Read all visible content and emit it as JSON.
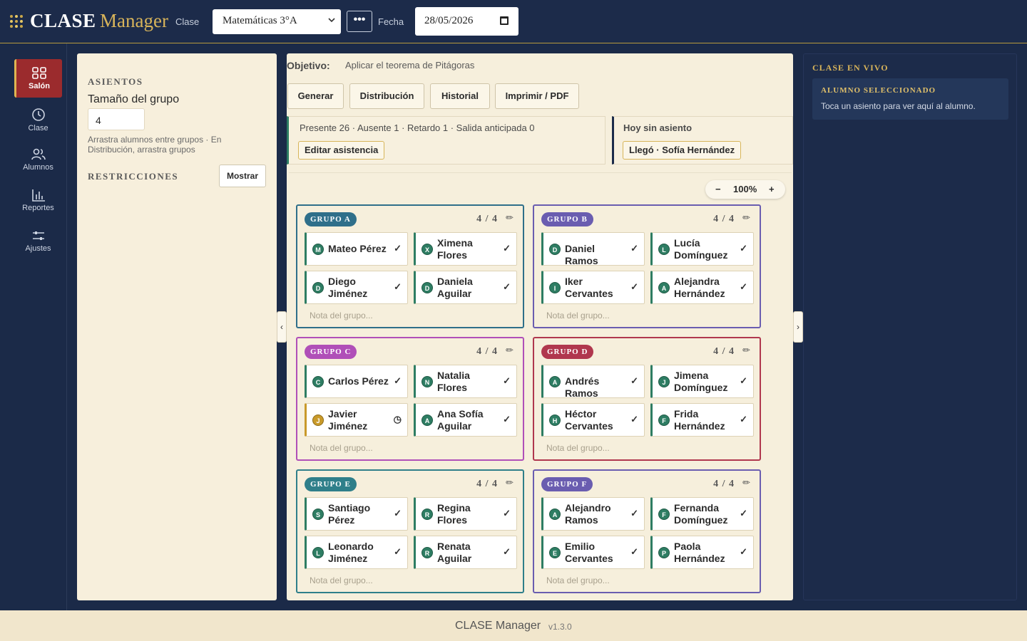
{
  "app": {
    "brand": "CLASE",
    "brand_sub": "Manager",
    "footer_name": "CLASE Manager",
    "version": "v1.3.0"
  },
  "topbar": {
    "class_label": "Clase",
    "class_value": "Matemáticas 3°A",
    "more_label": "•••",
    "date_label": "Fecha",
    "date_value": "28/05/2026"
  },
  "nav": [
    {
      "label": "Salón",
      "icon": "grid-icon",
      "active": true
    },
    {
      "label": "Clase",
      "icon": "clock-icon",
      "active": false
    },
    {
      "label": "Alumnos",
      "icon": "users-icon",
      "active": false
    },
    {
      "label": "Reportes",
      "icon": "bar-chart-icon",
      "active": false
    },
    {
      "label": "Ajustes",
      "icon": "sliders-icon",
      "active": false
    }
  ],
  "left": {
    "seats_title": "ASIENTOS",
    "group_size_label": "Tamaño del grupo",
    "group_size_value": "4",
    "hint": "Arrastra alumnos entre grupos · En Distribución, arrastra grupos",
    "restrictions_title": "RESTRICCIONES",
    "show_label": "Mostrar"
  },
  "main": {
    "objective_label": "Objetivo:",
    "objective_text": "Aplicar el teorema de Pitágoras",
    "tabs": [
      "Generar",
      "Distribución",
      "Historial",
      "Imprimir / PDF"
    ],
    "attendance_text": "Presente 26 · Ausente 1 · Retardo 1 · Salida anticipada 0",
    "edit_attendance": "Editar asistencia",
    "no_seat_title": "Hoy sin asiento",
    "arrived_label": "Llegó · Sofía Hernández",
    "zoom_minus": "−",
    "zoom_value": "100%",
    "zoom_plus": "+",
    "collapse_left": "‹",
    "collapse_right": "›"
  },
  "groups": [
    {
      "badge": "GRUPO A",
      "count": "4 / 4",
      "color": "#2f6f8a",
      "note": "Nota del grupo...",
      "seats": [
        {
          "initial": "M",
          "name": "Mateo Pérez",
          "status": "✓"
        },
        {
          "initial": "X",
          "name": "Ximena Flores",
          "status": "✓"
        },
        {
          "initial": "D",
          "name": "Diego Jiménez",
          "status": "✓"
        },
        {
          "initial": "D",
          "name": "Daniela Aguilar",
          "status": "✓"
        }
      ]
    },
    {
      "badge": "GRUPO B",
      "count": "4 / 4",
      "color": "#6a5db0",
      "note": "Nota del grupo...",
      "seats": [
        {
          "initial": "D",
          "name": "Daniel Ramos",
          "status": "✓"
        },
        {
          "initial": "L",
          "name": "Lucía Domínguez",
          "status": "✓"
        },
        {
          "initial": "I",
          "name": "Iker Cervantes",
          "status": "✓"
        },
        {
          "initial": "A",
          "name": "Alejandra Hernández",
          "status": "✓"
        }
      ]
    },
    {
      "badge": "GRUPO C",
      "count": "4 / 4",
      "color": "#b04fb8",
      "note": "Nota del grupo...",
      "seats": [
        {
          "initial": "C",
          "name": "Carlos Pérez",
          "status": "✓"
        },
        {
          "initial": "N",
          "name": "Natalia Flores",
          "status": "✓"
        },
        {
          "initial": "J",
          "name": "Javier Jiménez",
          "status": "◷",
          "late": true
        },
        {
          "initial": "A",
          "name": "Ana Sofía Aguilar",
          "status": "✓"
        }
      ]
    },
    {
      "badge": "GRUPO D",
      "count": "4 / 4",
      "color": "#b0374e",
      "note": "Nota del grupo...",
      "seats": [
        {
          "initial": "A",
          "name": "Andrés Ramos",
          "status": "✓"
        },
        {
          "initial": "J",
          "name": "Jimena Domínguez",
          "status": "✓"
        },
        {
          "initial": "H",
          "name": "Héctor Cervantes",
          "status": "✓"
        },
        {
          "initial": "F",
          "name": "Frida Hernández",
          "status": "✓"
        }
      ]
    },
    {
      "badge": "GRUPO E",
      "count": "4 / 4",
      "color": "#2f7f8a",
      "note": "Nota del grupo...",
      "seats": [
        {
          "initial": "S",
          "name": "Santiago Pérez",
          "status": "✓"
        },
        {
          "initial": "R",
          "name": "Regina Flores",
          "status": "✓"
        },
        {
          "initial": "L",
          "name": "Leonardo Jiménez",
          "status": "✓"
        },
        {
          "initial": "R",
          "name": "Renata Aguilar",
          "status": "✓"
        }
      ]
    },
    {
      "badge": "GRUPO F",
      "count": "4 / 4",
      "color": "#6a5db0",
      "note": "Nota del grupo...",
      "seats": [
        {
          "initial": "A",
          "name": "Alejandro Ramos",
          "status": "✓"
        },
        {
          "initial": "F",
          "name": "Fernanda Domínguez",
          "status": "✓"
        },
        {
          "initial": "E",
          "name": "Emilio Cervantes",
          "status": "✓"
        },
        {
          "initial": "P",
          "name": "Paola Hernández",
          "status": "✓"
        }
      ]
    }
  ],
  "right": {
    "live_title": "CLASE EN VIVO",
    "selected_title": "ALUMNO SELECCIONADO",
    "selected_hint": "Toca un asiento para ver aquí al alumno."
  }
}
